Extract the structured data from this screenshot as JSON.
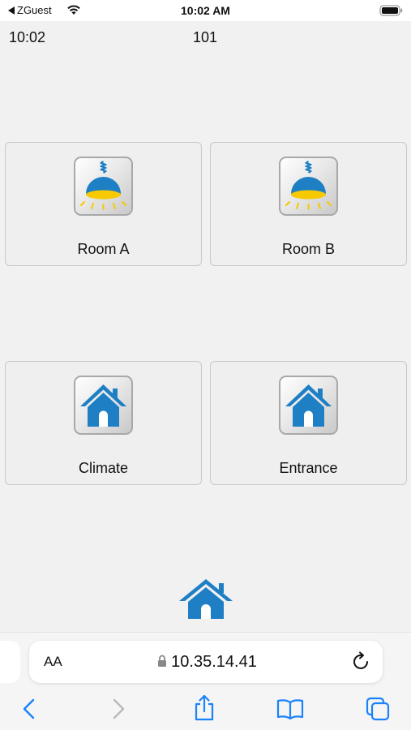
{
  "status_bar": {
    "back_app": "ZGuest",
    "time": "10:02 AM"
  },
  "app": {
    "time": "10:02",
    "room_number": "101",
    "tiles": [
      {
        "label": "Room A",
        "icon": "lamp-icon"
      },
      {
        "label": "Room B",
        "icon": "lamp-icon"
      },
      {
        "label": "Climate",
        "icon": "house-icon"
      },
      {
        "label": "Entrance",
        "icon": "house-icon"
      }
    ],
    "home_icon": "house-icon"
  },
  "browser": {
    "text_size_label": "AA",
    "url": "10.35.14.41",
    "toolbar": [
      "back-icon",
      "forward-icon",
      "share-icon",
      "bookmarks-icon",
      "tabs-icon"
    ]
  },
  "colors": {
    "accent_blue": "#1f7fc4",
    "lamp_yellow": "#f6c900",
    "ios_blue": "#1a82fb"
  }
}
